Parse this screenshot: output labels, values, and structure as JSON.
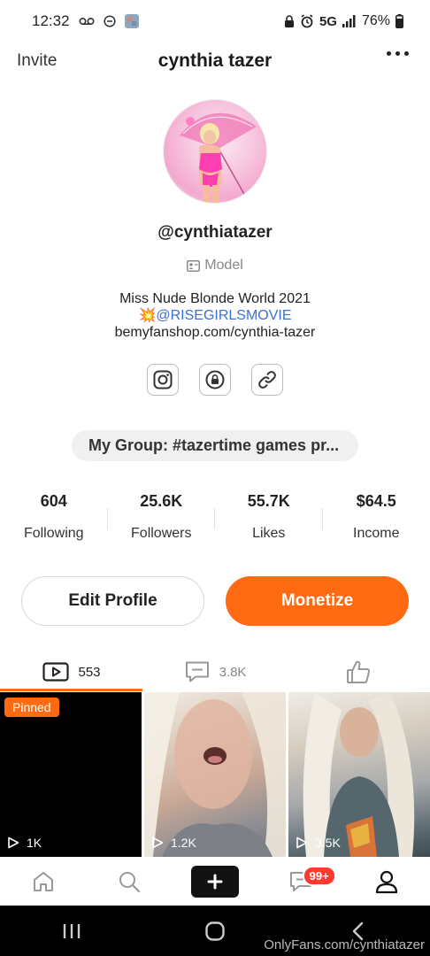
{
  "status_bar": {
    "time": "12:32",
    "network": "5G",
    "battery": "76%"
  },
  "header": {
    "invite_label": "Invite",
    "title": "cynthia tazer"
  },
  "profile": {
    "handle": "@cynthiatazer",
    "category": "Model",
    "bio_line1": "Miss Nude Blonde World 2021",
    "bio_emoji": "💥",
    "bio_link": "@RISEGIRLSMOVIE",
    "bio_line3": "bemyfanshop.com/cynthia-tazer"
  },
  "social_icons": [
    "instagram-icon",
    "lock-icon",
    "link-icon"
  ],
  "group": {
    "label": "My Group: #tazertime games pr..."
  },
  "stats": [
    {
      "value": "604",
      "label": "Following"
    },
    {
      "value": "25.6K",
      "label": "Followers"
    },
    {
      "value": "55.7K",
      "label": "Likes"
    },
    {
      "value": "$64.5",
      "label": "Income"
    }
  ],
  "buttons": {
    "edit": "Edit Profile",
    "monetize": "Monetize"
  },
  "tabs": [
    {
      "icon": "video-icon",
      "count": "553",
      "active": true
    },
    {
      "icon": "comment-icon",
      "count": "3.8K",
      "active": false
    },
    {
      "icon": "thumbs-up-icon",
      "count": "",
      "active": false
    }
  ],
  "videos": [
    {
      "pinned_label": "Pinned",
      "views": "1K"
    },
    {
      "views": "1.2K"
    },
    {
      "views": "3.5K"
    }
  ],
  "bottom_nav": {
    "messages_badge": "99+"
  },
  "watermark": "OnlyFans.com/cynthiatazer",
  "colors": {
    "accent": "#ff6a13",
    "badge": "#ff3b30",
    "link": "#3b6fd6"
  }
}
